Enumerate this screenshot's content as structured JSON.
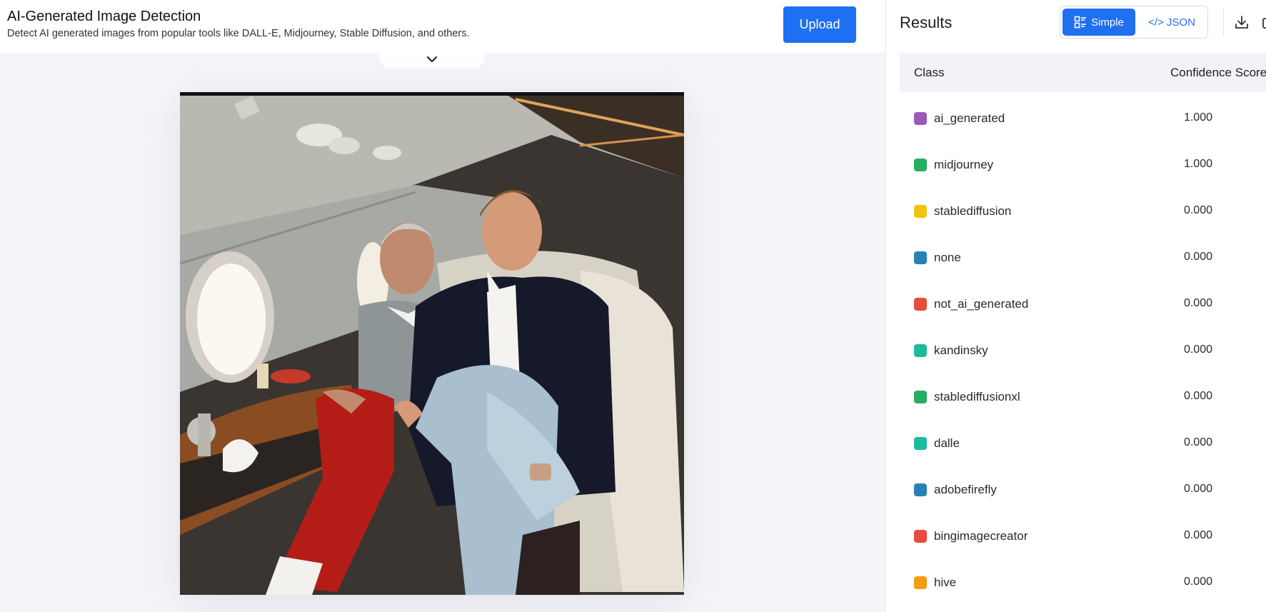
{
  "header": {
    "title": "AI-Generated Image Detection",
    "subtitle": "Detect AI generated images from popular tools like DALL-E, Midjourney, Stable Diffusion, and others.",
    "upload_label": "Upload"
  },
  "results": {
    "title": "Results",
    "toggle": {
      "simple_label": "Simple",
      "json_label": "</> JSON",
      "selected": "Simple"
    },
    "table": {
      "col_class": "Class",
      "col_score": "Confidence Score",
      "rows": [
        {
          "class": "ai_generated",
          "score": "1.000",
          "color": "#9b59b6"
        },
        {
          "class": "midjourney",
          "score": "1.000",
          "color": "#27ae60"
        },
        {
          "class": "stablediffusion",
          "score": "0.000",
          "color": "#f1c40f"
        },
        {
          "class": "none",
          "score": "0.000",
          "color": "#2980b9"
        },
        {
          "class": "not_ai_generated",
          "score": "0.000",
          "color": "#e74c3c"
        },
        {
          "class": "kandinsky",
          "score": "0.000",
          "color": "#1abc9c"
        },
        {
          "class": "stablediffusionxl",
          "score": "0.000",
          "color": "#27ae60"
        },
        {
          "class": "dalle",
          "score": "0.000",
          "color": "#1abc9c"
        },
        {
          "class": "adobefirefly",
          "score": "0.000",
          "color": "#2980b9"
        },
        {
          "class": "bingimagecreator",
          "score": "0.000",
          "color": "#e74c3c"
        },
        {
          "class": "hive",
          "score": "0.000",
          "color": "#f39c12"
        }
      ]
    }
  },
  "icons": {
    "collapse": "chevron-down-icon",
    "simple": "list-layout-icon",
    "download": "download-icon"
  },
  "colors": {
    "accent": "#1f6ff2"
  }
}
